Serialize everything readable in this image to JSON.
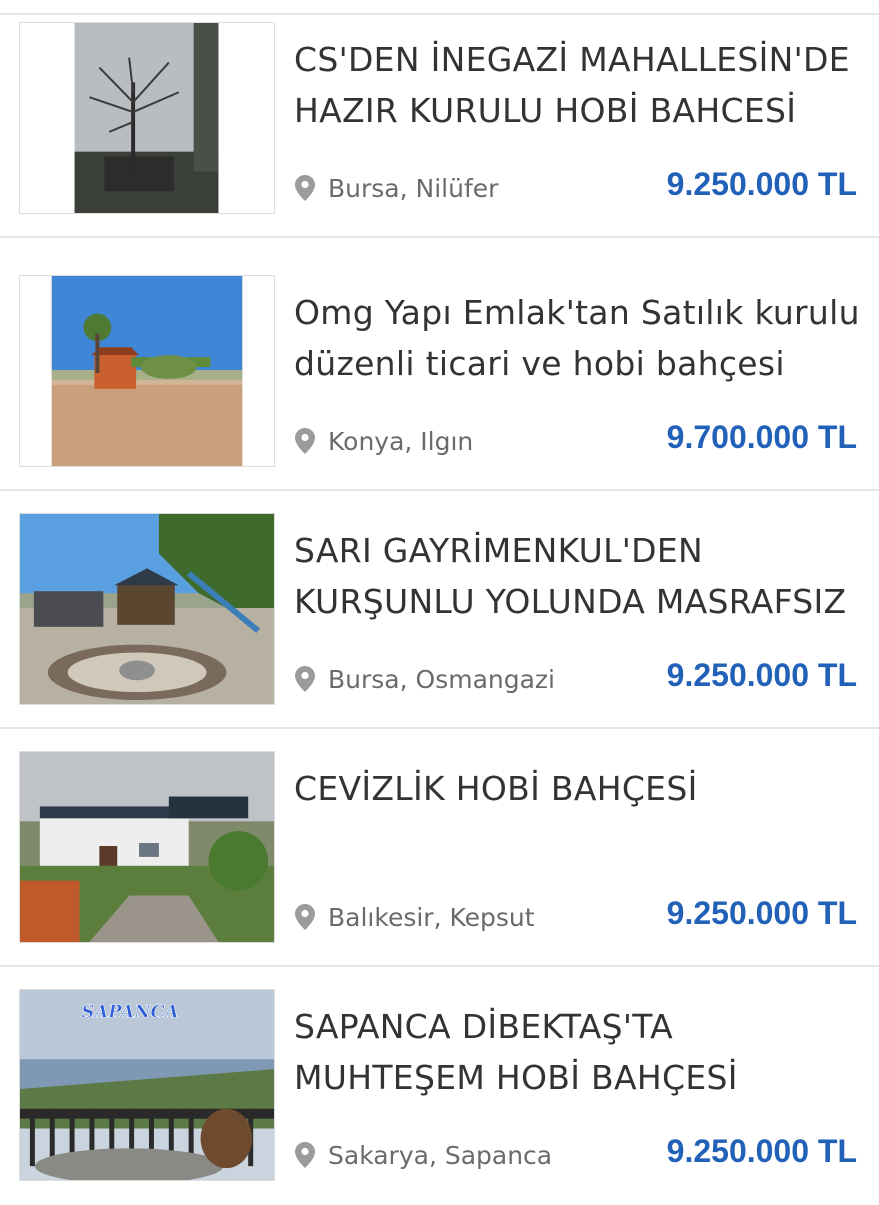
{
  "listings": [
    {
      "title_line1": "Omg Yapı Emlak'tan Satılık kurulu",
      "title_line2": "düzenli ticari ve hobi bahçesi",
      "location": "Konya, Ilgın",
      "price": "9.700.000 TL"
    },
    {
      "title_line1": "SARI GAYRİMENKUL'DEN",
      "title_line2": "KURŞUNLU YOLUNDA MASRAFSIZ",
      "location": "Bursa, Osmangazi",
      "price": "9.250.000 TL"
    },
    {
      "title_line1": "CEVİZLİK HOBİ BAHÇESİ",
      "title_line2": "",
      "location": "Balıkesir, Kepsut",
      "price": "9.250.000 TL"
    },
    {
      "title_line1": "SAPANCA DİBEKTAŞ'TA",
      "title_line2": "MUHTEŞEM HOBİ BAHÇESİ",
      "location": "Sakarya, Sapanca",
      "price": "9.250.000 TL",
      "image_caption": "SAPANCA"
    },
    {
      "title_line1": "CS'DEN İNEGAZİ MAHALLESİN'DE",
      "title_line2": "HAZIR KURULU HOBİ BAHCESİ",
      "location": "Bursa, Nilüfer",
      "price": "9.250.000 TL"
    }
  ],
  "colors": {
    "price": "#2161b8",
    "location": "#6b6b6b",
    "title": "#333333",
    "divider": "#e5e5e5",
    "pin": "#9b9b9b"
  },
  "icons": {
    "location": "location-pin-icon"
  }
}
